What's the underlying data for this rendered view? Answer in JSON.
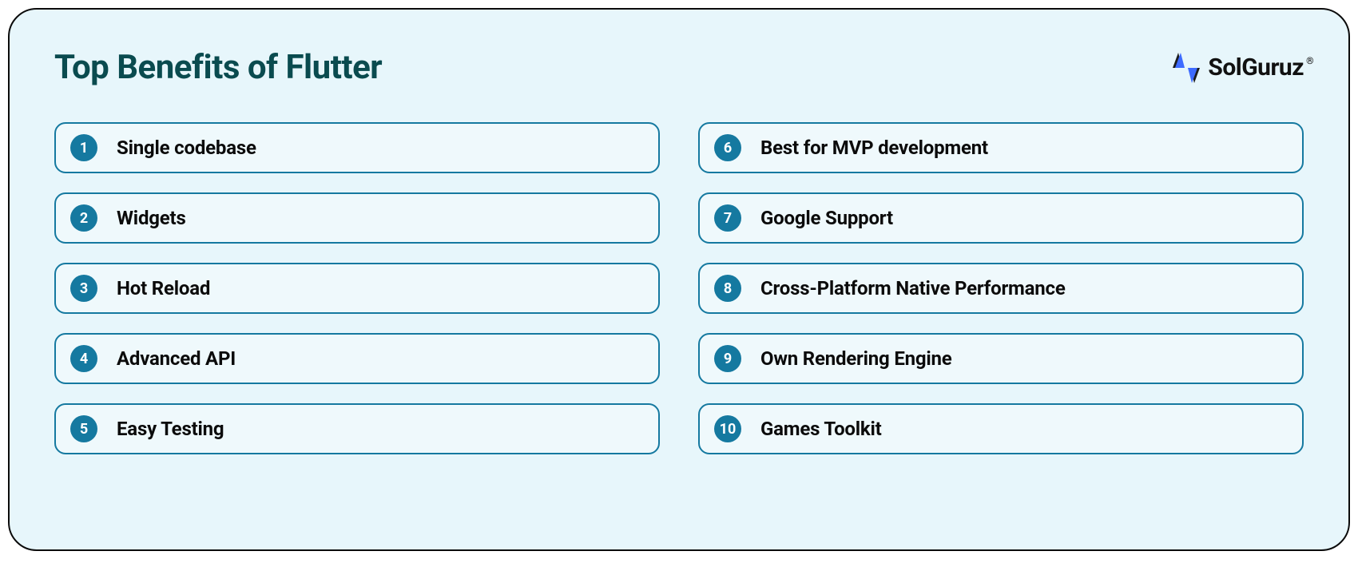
{
  "title": "Top Benefits of Flutter",
  "brand": {
    "name": "SolGuruz",
    "registered_mark": "®"
  },
  "colors": {
    "card_bg": "#e7f6fb",
    "item_bg": "#eff9fc",
    "accent": "#1579a0",
    "title_color": "#0a4b4f"
  },
  "benefits": [
    {
      "n": "1",
      "label": "Single codebase"
    },
    {
      "n": "2",
      "label": "Widgets"
    },
    {
      "n": "3",
      "label": "Hot Reload"
    },
    {
      "n": "4",
      "label": "Advanced API"
    },
    {
      "n": "5",
      "label": "Easy Testing"
    },
    {
      "n": "6",
      "label": "Best for MVP development"
    },
    {
      "n": "7",
      "label": "Google Support"
    },
    {
      "n": "8",
      "label": "Cross-Platform Native Performance"
    },
    {
      "n": "9",
      "label": "Own Rendering Engine"
    },
    {
      "n": "10",
      "label": "Games Toolkit"
    }
  ]
}
